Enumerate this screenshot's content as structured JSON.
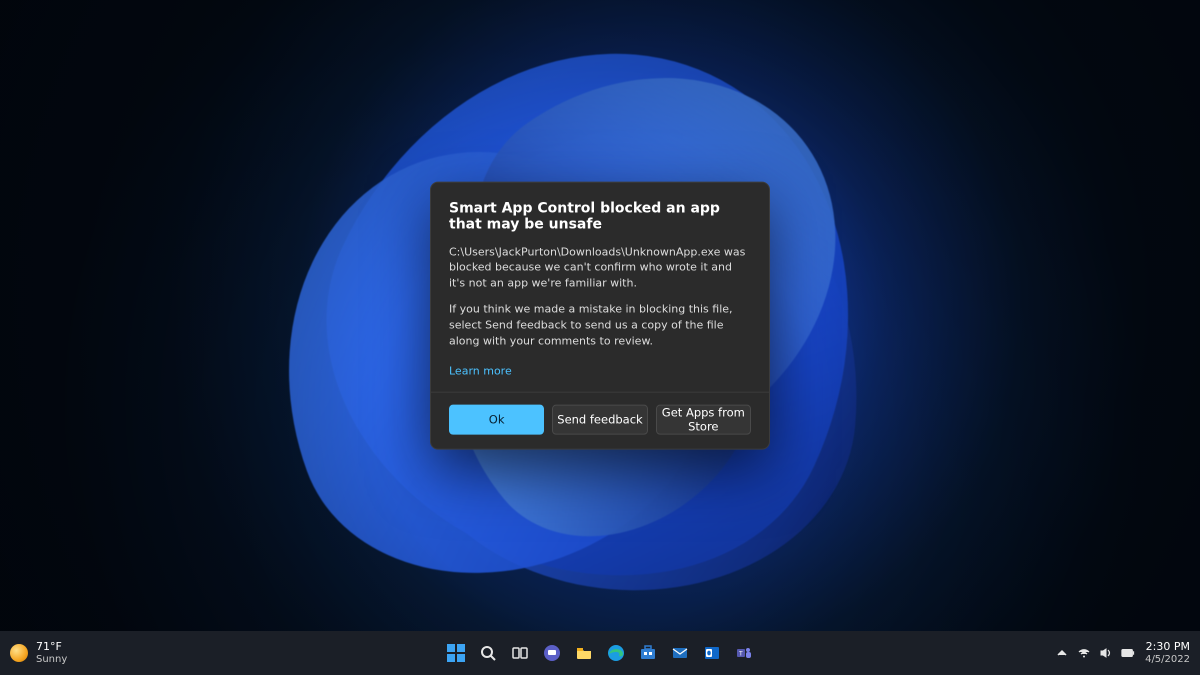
{
  "dialog": {
    "title": "Smart App Control blocked an app that may be unsafe",
    "body1": "C:\\Users\\JackPurton\\Downloads\\UnknownApp.exe was blocked because we can't confirm who wrote it and it's not an app we're familiar with.",
    "body2": "If you think we made a mistake in blocking this file, select Send feedback to send us a copy of the file along with your comments to review.",
    "learn_more": "Learn more",
    "buttons": {
      "ok": "Ok",
      "feedback": "Send feedback",
      "store": "Get Apps from Store"
    }
  },
  "taskbar": {
    "weather": {
      "temp": "71°F",
      "condition": "Sunny"
    },
    "clock": {
      "time": "2:30 PM",
      "date": "4/5/2022"
    },
    "center_icons": [
      "start-icon",
      "search-icon",
      "task-view-icon",
      "chat-icon",
      "file-explorer-icon",
      "edge-icon",
      "store-icon",
      "mail-icon",
      "outlook-icon",
      "teams-icon"
    ],
    "tray_icons": [
      "chevron-up-icon",
      "wifi-icon",
      "volume-icon",
      "battery-icon"
    ]
  }
}
